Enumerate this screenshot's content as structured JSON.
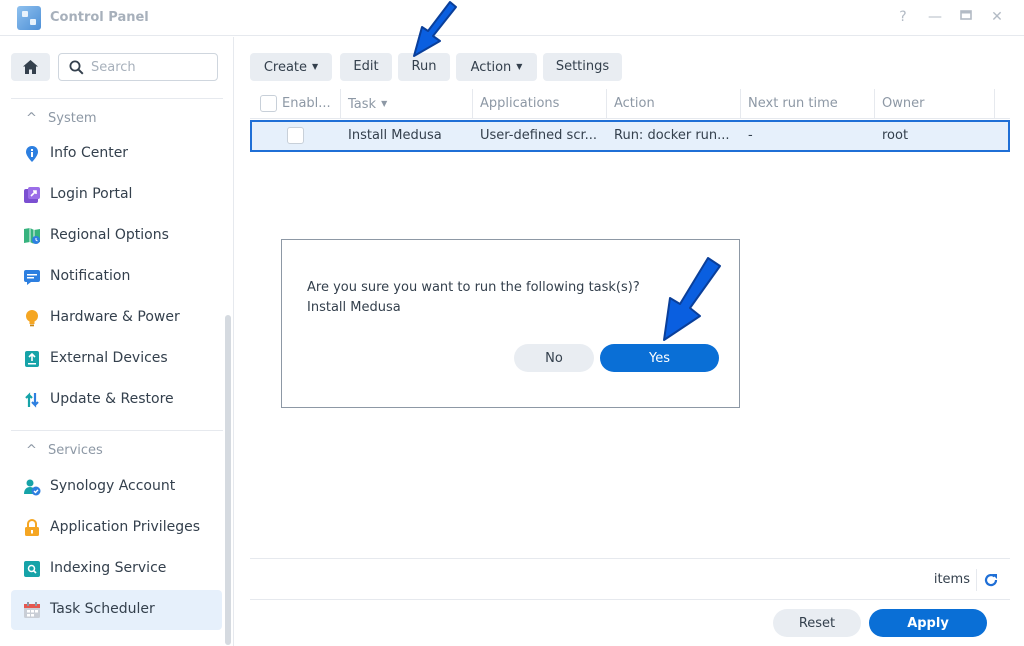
{
  "window": {
    "title": "Control Panel",
    "help": "?",
    "minimize": "—",
    "maximize": "□",
    "close": "✕"
  },
  "sidebar": {
    "search_placeholder": "Search",
    "sections": [
      {
        "title": "System",
        "items": [
          {
            "label": "Info Center",
            "icon": "info-icon"
          },
          {
            "label": "Login Portal",
            "icon": "login-portal-icon"
          },
          {
            "label": "Regional Options",
            "icon": "regional-options-icon"
          },
          {
            "label": "Notification",
            "icon": "notification-icon"
          },
          {
            "label": "Hardware & Power",
            "icon": "lightbulb-icon"
          },
          {
            "label": "External Devices",
            "icon": "external-devices-icon"
          },
          {
            "label": "Update & Restore",
            "icon": "update-restore-icon"
          }
        ]
      },
      {
        "title": "Services",
        "items": [
          {
            "label": "Synology Account",
            "icon": "account-icon"
          },
          {
            "label": "Application Privileges",
            "icon": "lock-icon"
          },
          {
            "label": "Indexing Service",
            "icon": "indexing-icon"
          },
          {
            "label": "Task Scheduler",
            "icon": "calendar-icon",
            "active": true
          }
        ]
      }
    ]
  },
  "toolbar": {
    "create": "Create",
    "edit": "Edit",
    "run": "Run",
    "action": "Action",
    "settings": "Settings"
  },
  "grid": {
    "columns": [
      "Enabl...",
      "Task",
      "Applications",
      "Action",
      "Next run time",
      "Owner"
    ],
    "rows": [
      {
        "enabled": false,
        "task": "Install Medusa",
        "applications": "User-defined scr...",
        "action": "Run: docker run...",
        "next_run": "-",
        "owner": "root"
      }
    ],
    "footer_items": "items"
  },
  "footer": {
    "reset": "Reset",
    "apply": "Apply"
  },
  "dialog": {
    "message": "Are you sure you want to run the following task(s)?",
    "task": "Install Medusa",
    "no": "No",
    "yes": "Yes"
  },
  "colors": {
    "accent": "#0a6fd6",
    "selection_border": "#1f6fd6",
    "selection_bg": "#e6f0fb",
    "annotation_arrow": "#0a5fe0"
  }
}
